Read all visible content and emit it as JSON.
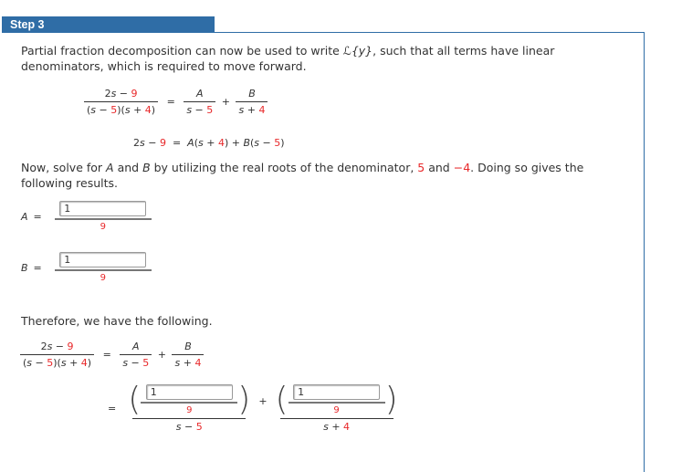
{
  "step": {
    "title": "Step 3"
  },
  "intro": {
    "text1": "Partial fraction decomposition can now be used to write ",
    "laplace": "ℒ{y}",
    "text2": ", such that all terms have linear denominators, which is required to move forward."
  },
  "eq1": {
    "lhs_num": [
      {
        "t": "2",
        "r": 0
      },
      {
        "t": "s",
        "r": 0,
        "i": 1
      },
      {
        "t": " − ",
        "r": 0
      },
      {
        "t": "9",
        "r": 1
      }
    ],
    "lhs_den": [
      {
        "t": "(",
        "r": 0
      },
      {
        "t": "s",
        "i": 1
      },
      {
        "t": " − "
      },
      {
        "t": "5",
        "r": 1
      },
      {
        "t": ")("
      },
      {
        "t": "s",
        "i": 1
      },
      {
        "t": " + "
      },
      {
        "t": "4",
        "r": 1
      },
      {
        "t": ")"
      }
    ],
    "eq": "=",
    "a_num": [
      {
        "t": "A",
        "i": 1
      }
    ],
    "a_den": [
      {
        "t": "s",
        "i": 1
      },
      {
        "t": " − "
      },
      {
        "t": "5",
        "r": 1
      }
    ],
    "plus": "+",
    "b_num": [
      {
        "t": "B",
        "i": 1
      }
    ],
    "b_den": [
      {
        "t": "s",
        "i": 1
      },
      {
        "t": " + "
      },
      {
        "t": "4",
        "r": 1
      }
    ]
  },
  "eq2": [
    {
      "t": "2"
    },
    {
      "t": "s",
      "i": 1
    },
    {
      "t": " − "
    },
    {
      "t": "9",
      "r": 1
    },
    {
      "t": "  =  "
    },
    {
      "t": "A",
      "i": 1
    },
    {
      "t": "("
    },
    {
      "t": "s",
      "i": 1
    },
    {
      "t": " + "
    },
    {
      "t": "4",
      "r": 1
    },
    {
      "t": ") + "
    },
    {
      "t": "B",
      "i": 1
    },
    {
      "t": "("
    },
    {
      "t": "s",
      "i": 1
    },
    {
      "t": " − "
    },
    {
      "t": "5",
      "r": 1
    },
    {
      "t": ")"
    }
  ],
  "solve": {
    "text1": "Now, solve for ",
    "A": "A",
    "and": " and ",
    "B": "B",
    "text2": " by utilizing the real roots of the denominator, ",
    "root1": "5",
    "and2": " and ",
    "root2": "−4",
    "text3": ". Doing so gives the following results."
  },
  "answers": {
    "a_label": "A",
    "b_label": "B",
    "eq": "=",
    "a_value": "1",
    "a_den": "9",
    "b_value": "1",
    "b_den": "9"
  },
  "therefore": "Therefore, we have the following.",
  "final": {
    "eq": "=",
    "plus": "+",
    "a_value": "1",
    "a_den": "9",
    "b_value": "1",
    "b_den": "9",
    "den1": [
      {
        "t": "s",
        "i": 1
      },
      {
        "t": " − "
      },
      {
        "t": "5",
        "r": 1
      }
    ],
    "den2": [
      {
        "t": "s",
        "i": 1
      },
      {
        "t": " + "
      },
      {
        "t": "4",
        "r": 1
      }
    ]
  },
  "colors": {
    "header": "#2f6da6",
    "highlight": "#e8282a"
  }
}
